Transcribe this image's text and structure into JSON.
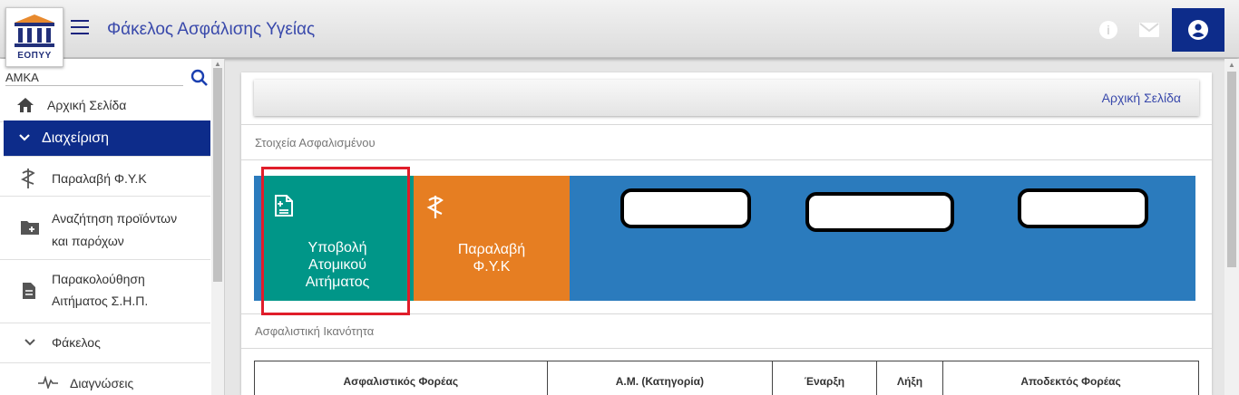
{
  "header": {
    "logo_text": "ΕΟΠΥΥ",
    "title": "Φάκελος Ασφάλισης Υγείας",
    "icons": {
      "menu": "hamburger-icon",
      "info": "info-icon",
      "mail": "mail-icon",
      "account": "account-circle-icon"
    }
  },
  "sidebar": {
    "amka_value": "ΑΜΚΑ",
    "items": [
      {
        "label": "Αρχική Σελίδα",
        "icon": "home-icon"
      },
      {
        "label": "Διαχείριση",
        "icon": "chevron-down-icon",
        "active": true
      },
      {
        "label": "Παραλαβή Φ.Υ.Κ",
        "icon": "caduceus-icon"
      },
      {
        "line1": "Αναζήτηση προϊόντων",
        "line2": "και παρόχων",
        "icon": "folder-add-icon"
      },
      {
        "line1": "Παρακολούθηση",
        "line2": "Αιτήματος Σ.Η.Π.",
        "icon": "document-icon"
      },
      {
        "label": "Φάκελος",
        "icon": "chevron-down-icon"
      },
      {
        "label": "Διαγνώσεις",
        "icon": "pulse-icon"
      }
    ]
  },
  "main": {
    "breadcrumb": "Αρχική Σελίδα",
    "section_insured": "Στοιχεία Ασφαλισμένου",
    "tiles": {
      "submit": {
        "line1": "Υποβολή",
        "line2": "Ατομικού",
        "line3": "Αιτήματος",
        "icon": "document-add-icon"
      },
      "fyk": {
        "line1": "Παραλαβή",
        "line2": "Φ.Υ.Κ",
        "icon": "caduceus-icon"
      }
    },
    "section_capacity": "Ασφαλιστική Ικανότητα",
    "table": {
      "headers": [
        "Ασφαλιστικός Φορέας",
        "Α.Μ. (Κατηγορία)",
        "Έναρξη",
        "Λήξη",
        "Αποδεκτός Φορέας"
      ]
    }
  },
  "colors": {
    "brand_dark": "#0d2c8a",
    "title_blue": "#3949ab",
    "tile_teal": "#009688",
    "tile_orange": "#e67e22",
    "tile_blue": "#2b7bbd",
    "highlight_red": "#e01d2a"
  }
}
